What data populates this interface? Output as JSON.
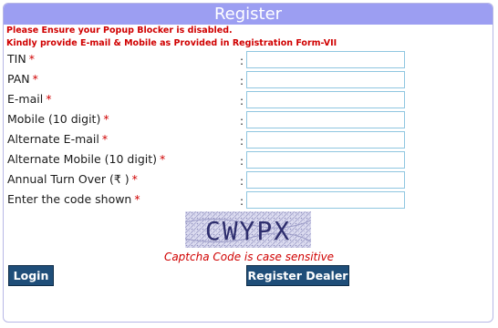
{
  "form": {
    "title": "Register",
    "notices": [
      "Please Ensure your Popup Blocker is disabled.",
      "Kindly provide E-mail & Mobile as Provided in Registration Form-VII"
    ],
    "fields": [
      {
        "label": "TIN",
        "value": ""
      },
      {
        "label": "PAN",
        "value": ""
      },
      {
        "label": "E-mail",
        "value": ""
      },
      {
        "label": "Mobile (10 digit)",
        "value": ""
      },
      {
        "label": "Alternate E-mail",
        "value": ""
      },
      {
        "label": "Alternate Mobile (10 digit)",
        "value": ""
      },
      {
        "label": "Annual Turn Over (₹ )",
        "value": ""
      },
      {
        "label": "Enter the code shown",
        "value": ""
      }
    ],
    "required_mark": "*",
    "colon": ":",
    "captcha_text": "CWYPX",
    "captcha_note": "Captcha Code is case sensitive",
    "login_label": "Login",
    "register_label": "Register Dealer"
  },
  "colors": {
    "header": "#9c9ef2",
    "button": "#1f4e79",
    "warning": "#d00000",
    "field_border": "#8fc6e0"
  }
}
